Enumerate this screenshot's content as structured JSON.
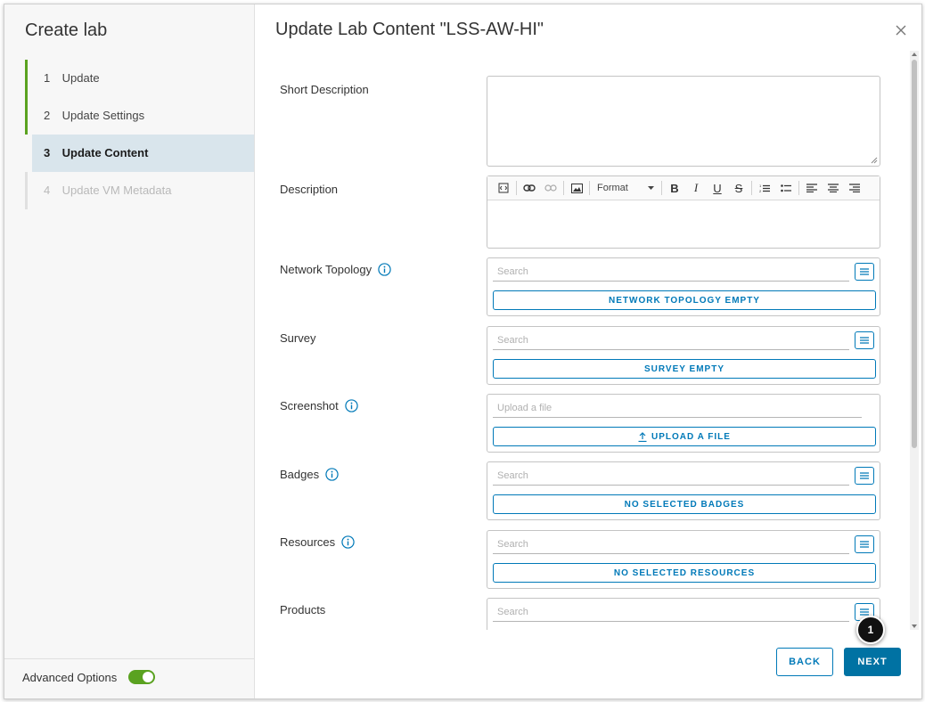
{
  "sidebar": {
    "title": "Create lab",
    "steps": [
      {
        "num": "1",
        "label": "Update",
        "state": "done"
      },
      {
        "num": "2",
        "label": "Update Settings",
        "state": "done"
      },
      {
        "num": "3",
        "label": "Update Content",
        "state": "active"
      },
      {
        "num": "4",
        "label": "Update VM Metadata",
        "state": "future"
      }
    ],
    "advanced_options_label": "Advanced Options",
    "advanced_options_on": true
  },
  "main": {
    "title": "Update Lab Content \"LSS-AW-HI\"",
    "fields": {
      "short_description": {
        "label": "Short Description",
        "value": ""
      },
      "description": {
        "label": "Description",
        "format_label": "Format"
      },
      "network_topology": {
        "label": "Network Topology",
        "search_placeholder": "Search",
        "button": "NETWORK TOPOLOGY EMPTY"
      },
      "survey": {
        "label": "Survey",
        "search_placeholder": "Search",
        "button": "SURVEY EMPTY"
      },
      "screenshot": {
        "label": "Screenshot",
        "upload_placeholder": "Upload a file",
        "button": "UPLOAD A FILE"
      },
      "badges": {
        "label": "Badges",
        "search_placeholder": "Search",
        "button": "NO SELECTED BADGES"
      },
      "resources": {
        "label": "Resources",
        "search_placeholder": "Search",
        "button": "NO SELECTED RESOURCES"
      },
      "products": {
        "label": "Products",
        "search_placeholder": "Search"
      }
    }
  },
  "footer": {
    "back_label": "BACK",
    "next_label": "NEXT"
  },
  "callout": {
    "number": "1"
  },
  "colors": {
    "accent": "#0079b8",
    "primary": "#0072a3",
    "success": "#5aa220"
  },
  "toolbar_icons": [
    "source-icon",
    "link-icon",
    "unlink-icon",
    "image-icon",
    "bold-icon",
    "italic-icon",
    "underline-icon",
    "strikethrough-icon",
    "numbered-list-icon",
    "bulleted-list-icon",
    "align-left-icon",
    "align-center-icon",
    "align-right-icon"
  ]
}
